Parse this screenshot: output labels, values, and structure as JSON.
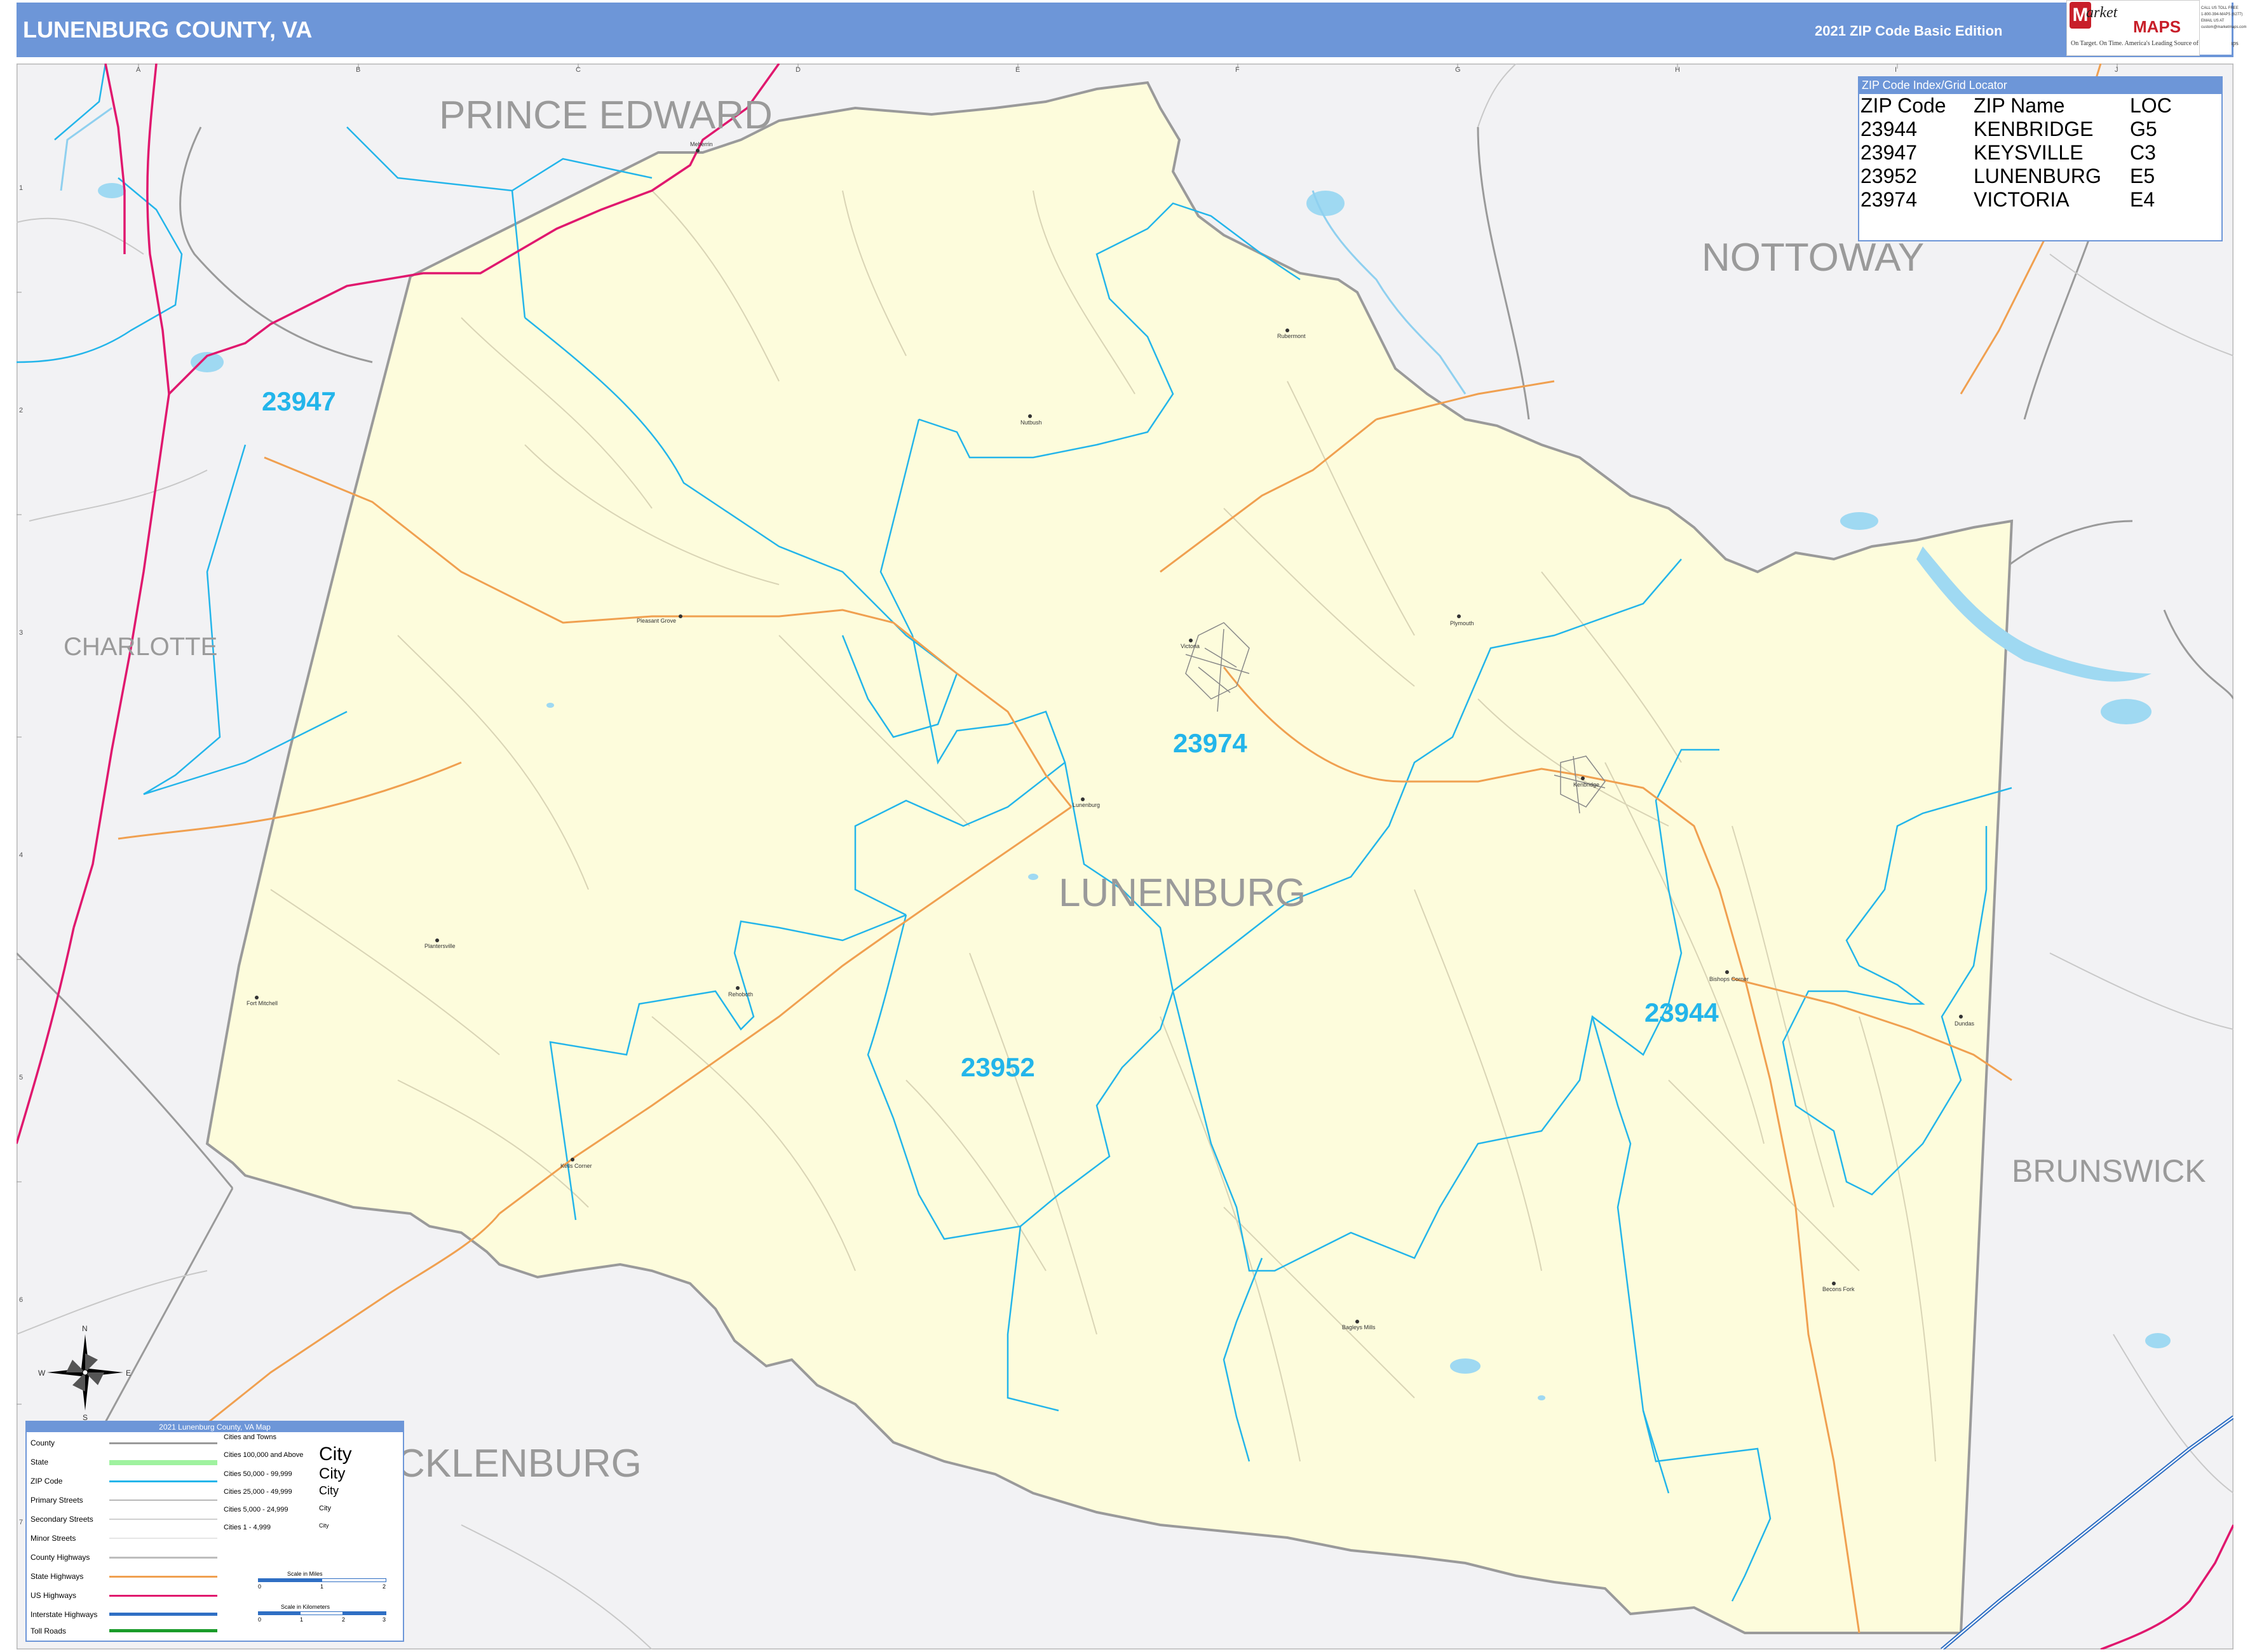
{
  "header": {
    "title": "LUNENBURG COUNTY, VA",
    "edition": "2021 ZIP Code Basic Edition",
    "logo_word_1": "arket",
    "logo_word_2": "MAPS",
    "logo_tagline": "On Target. On Time. America's Leading Source of Business Maps",
    "contact_lines": [
      "CALL US TOLL FREE",
      "1-800-394-MAPS (6277)",
      "EMAIL US AT",
      "custom@marketmaps.com"
    ]
  },
  "grid": {
    "columns": [
      "A",
      "B",
      "C",
      "D",
      "E",
      "F",
      "G",
      "H",
      "I",
      "J"
    ],
    "rows": [
      "1",
      "2",
      "3",
      "4",
      "5",
      "6",
      "7"
    ]
  },
  "counties": {
    "prince_edward": "PRINCE EDWARD",
    "nottoway": "NOTTOWAY",
    "charlotte": "CHARLOTTE",
    "brunswick": "BRUNSWICK",
    "mecklenburg": "CKLENBURG",
    "lunenburg": "LUNENBURG"
  },
  "zip_labels": {
    "z23947": "23947",
    "z23974": "23974",
    "z23952": "23952",
    "z23944": "23944"
  },
  "places": {
    "meherrin": "Meherrin",
    "rubermont": "Rubermont",
    "nutbush": "Nutbush",
    "pleasant_grove": "Pleasant Grove",
    "victoria": "Victoria",
    "plymouth": "Plymouth",
    "lunenburg": "Lunenburg",
    "kenbridge": "Kenbridge",
    "plantersville": "Plantersville",
    "fort_mitchell": "Fort Mitchell",
    "rehoboth": "Rehoboth",
    "bishops_corner": "Bishops Corner",
    "dundas": "Dundas",
    "kells_corner": "Kells Corner",
    "baileys_mills": "Bagleys Mills",
    "becons_fork": "Becons Fork"
  },
  "zip_index": {
    "title": "ZIP Code Index/Grid Locator",
    "headers": [
      "ZIP Code",
      "ZIP Name",
      "LOC"
    ],
    "rows": [
      [
        "23944",
        "KENBRIDGE",
        "G5"
      ],
      [
        "23947",
        "KEYSVILLE",
        "C3"
      ],
      [
        "23952",
        "LUNENBURG",
        "E5"
      ],
      [
        "23974",
        "VICTORIA",
        "E4"
      ]
    ]
  },
  "compass": {
    "n": "N",
    "s": "S",
    "e": "E",
    "w": "W"
  },
  "legend": {
    "title": "2021 Lunenburg County, VA Map",
    "items": [
      {
        "label": "County",
        "color": "#9a9a9a"
      },
      {
        "label": "State",
        "color": "#9ff29f"
      },
      {
        "label": "ZIP Code",
        "color": "#23b5ea"
      },
      {
        "label": "Primary Streets",
        "color": "#b8b8b8"
      },
      {
        "label": "Secondary Streets",
        "color": "#cfcfcf"
      },
      {
        "label": "Minor Streets",
        "color": "#e6e6e6"
      },
      {
        "label": "County Highways",
        "color": "#bdbdbd"
      },
      {
        "label": "State Highways",
        "color": "#f0a050"
      },
      {
        "label": "US Highways",
        "color": "#e0186e"
      },
      {
        "label": "Interstate Highways",
        "color": "#2f6fc4"
      },
      {
        "label": "Toll Roads",
        "color": "#1a9c2a"
      }
    ],
    "cities_title": "Cities and Towns",
    "city_rows": [
      {
        "label": "Cities 100,000 and Above",
        "sample": "City"
      },
      {
        "label": "Cities 50,000 - 99,999",
        "sample": "City"
      },
      {
        "label": "Cities 25,000 - 49,999",
        "sample": "City"
      },
      {
        "label": "Cities 5,000 - 24,999",
        "sample": "City"
      },
      {
        "label": "Cities 1 - 4,999",
        "sample": "City"
      }
    ],
    "scale_miles": "Scale in Miles",
    "scale_km": "Scale in Kilometers",
    "miles_ticks": [
      "0",
      "1",
      "2"
    ],
    "km_ticks": [
      "0",
      "1",
      "2",
      "3"
    ]
  },
  "colors": {
    "county_fill": "#fdfcdc",
    "zip_line": "#23b5ea",
    "us_highway": "#e0186e",
    "state_highway": "#f0a050",
    "water": "#9fd9f2",
    "border": "#9a9a9a",
    "header_bg": "#6d96d8"
  }
}
